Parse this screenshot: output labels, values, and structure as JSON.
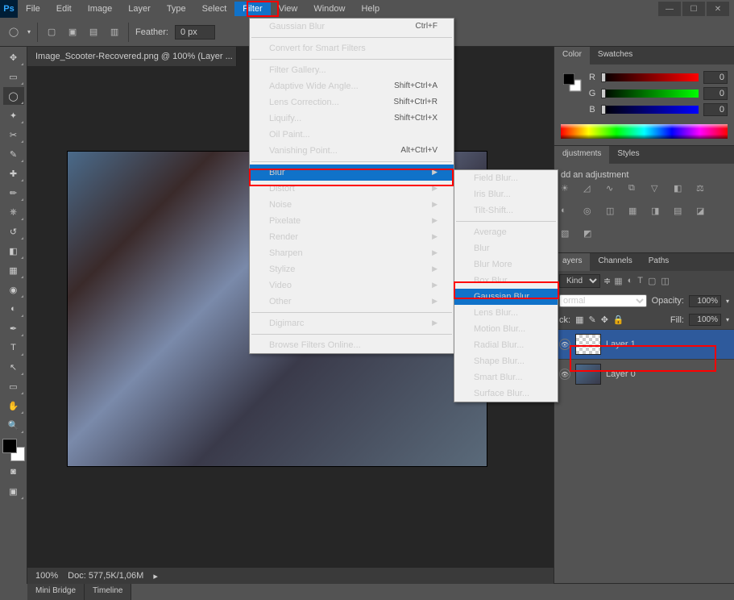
{
  "app": {
    "logo": "Ps"
  },
  "menus": [
    "File",
    "Edit",
    "Image",
    "Layer",
    "Type",
    "Select",
    "Filter",
    "View",
    "Window",
    "Help"
  ],
  "activeMenuIndex": 6,
  "optbar": {
    "feather_label": "Feather:",
    "feather_value": "0 px"
  },
  "doc": {
    "tab": "Image_Scooter-Recovered.png @ 100% (Layer ...",
    "zoom": "100%",
    "status": "Doc: 577,5K/1,06M"
  },
  "filterMenu": {
    "top": [
      {
        "label": "Gaussian Blur",
        "shortcut": "Ctrl+F"
      }
    ],
    "convert": {
      "label": "Convert for Smart Filters"
    },
    "group1": [
      {
        "label": "Filter Gallery..."
      },
      {
        "label": "Adaptive Wide Angle...",
        "shortcut": "Shift+Ctrl+A"
      },
      {
        "label": "Lens Correction...",
        "shortcut": "Shift+Ctrl+R"
      },
      {
        "label": "Liquify...",
        "shortcut": "Shift+Ctrl+X"
      },
      {
        "label": "Oil Paint..."
      },
      {
        "label": "Vanishing Point...",
        "shortcut": "Alt+Ctrl+V"
      }
    ],
    "group2": [
      {
        "label": "Blur",
        "sub": true,
        "hl": true
      },
      {
        "label": "Distort",
        "sub": true
      },
      {
        "label": "Noise",
        "sub": true
      },
      {
        "label": "Pixelate",
        "sub": true
      },
      {
        "label": "Render",
        "sub": true
      },
      {
        "label": "Sharpen",
        "sub": true
      },
      {
        "label": "Stylize",
        "sub": true
      },
      {
        "label": "Video",
        "sub": true
      },
      {
        "label": "Other",
        "sub": true
      }
    ],
    "digimarc": {
      "label": "Digimarc",
      "sub": true
    },
    "browse": {
      "label": "Browse Filters Online..."
    }
  },
  "blurSubmenu": {
    "group1": [
      "Field Blur...",
      "Iris Blur...",
      "Tilt-Shift..."
    ],
    "group2": [
      "Average",
      "Blur",
      "Blur More",
      "Box Blur...",
      "Gaussian Blur...",
      "Lens Blur...",
      "Motion Blur...",
      "Radial Blur...",
      "Shape Blur...",
      "Smart Blur...",
      "Surface Blur..."
    ],
    "hlIndex": 4
  },
  "color": {
    "r": "0",
    "g": "0",
    "b": "0",
    "tab1": "Color",
    "tab2": "Swatches",
    "R": "R",
    "G": "G",
    "B": "B"
  },
  "adjust": {
    "tab1": "djustments",
    "tab2": "Styles",
    "title": "dd an adjustment"
  },
  "layers": {
    "tabs": [
      "ayers",
      "Channels",
      "Paths"
    ],
    "kind": "Kind",
    "mode": "ormal",
    "opacity_label": "Opacity:",
    "opacity": "100%",
    "lock_label": "ck:",
    "fill_label": "Fill:",
    "fill": "100%",
    "items": [
      {
        "name": "Layer 1",
        "sel": true
      },
      {
        "name": "Layer 0",
        "sel": false
      }
    ]
  },
  "dock": {
    "tab1": "Mini Bridge",
    "tab2": "Timeline"
  }
}
